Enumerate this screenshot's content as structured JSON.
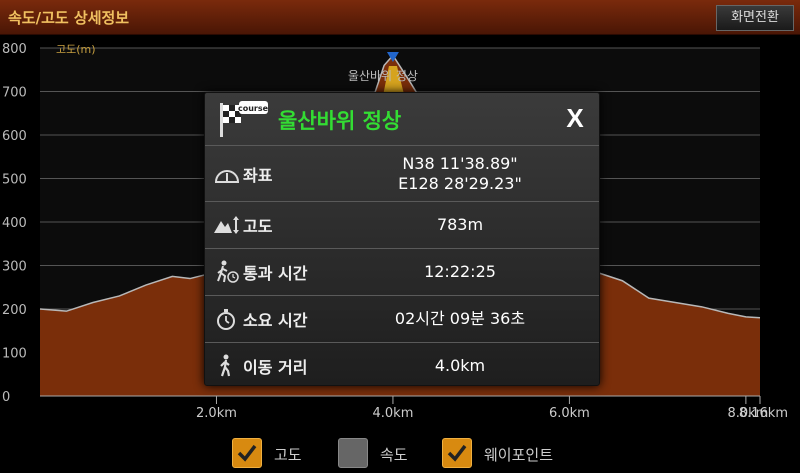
{
  "header": {
    "title": "속도/고도 상세정보",
    "switch_label": "화면전환"
  },
  "chart_data": {
    "type": "area",
    "ylabel": "고도(m)",
    "ylim": [
      0,
      800
    ],
    "y_ticks": [
      "0",
      "100",
      "200",
      "300",
      "400",
      "500",
      "600",
      "700",
      "800"
    ],
    "x_ticks": [
      {
        "value": 2.0,
        "label": "2.0km"
      },
      {
        "value": 4.0,
        "label": "4.0km"
      },
      {
        "value": 6.0,
        "label": "6.0km"
      },
      {
        "value": 8.0,
        "label": "8.0km"
      },
      {
        "value": 8.16,
        "label": "8.16km"
      }
    ],
    "xlim": [
      0,
      8.16
    ],
    "x": [
      0,
      0.3,
      0.6,
      0.9,
      1.2,
      1.5,
      1.7,
      2.0,
      2.3,
      2.6,
      2.9,
      3.2,
      3.5,
      3.7,
      3.9,
      4.0,
      4.2,
      4.5,
      4.8,
      5.1,
      5.4,
      5.7,
      6.0,
      6.3,
      6.6,
      6.9,
      7.2,
      7.5,
      7.8,
      8.0,
      8.16
    ],
    "series": [
      {
        "values": [
          200,
          195,
          215,
          230,
          255,
          275,
          270,
          285,
          300,
          320,
          360,
          420,
          520,
          640,
          760,
          783,
          720,
          620,
          520,
          460,
          400,
          330,
          295,
          285,
          265,
          225,
          215,
          205,
          190,
          182,
          180
        ]
      }
    ],
    "waypoint": {
      "x": 4.0,
      "label": "울산바위 정상"
    },
    "colors": {
      "fill": "#7a2e0a",
      "line": "#b8b8b8",
      "grid": "#555555",
      "marker": "#e0b020"
    }
  },
  "popup": {
    "title": "울산바위 정상",
    "close_label": "X",
    "rows": [
      {
        "icon": "gauge-icon",
        "label": "좌표",
        "value": "N38 11'38.89\"",
        "value2": "E128 28'29.23\""
      },
      {
        "icon": "mountain-altitude-icon",
        "label": "고도",
        "value": "783m"
      },
      {
        "icon": "hiker-clock-icon",
        "label": "통과 시간",
        "value": "12:22:25"
      },
      {
        "icon": "stopwatch-icon",
        "label": "소요 시간",
        "value": "02시간 09분 36초"
      },
      {
        "icon": "walker-icon",
        "label": "이동 거리",
        "value": "4.0km"
      }
    ]
  },
  "legend": [
    {
      "label": "고도",
      "checked": true
    },
    {
      "label": "속도",
      "checked": false
    },
    {
      "label": "웨이포인트",
      "checked": true
    }
  ]
}
